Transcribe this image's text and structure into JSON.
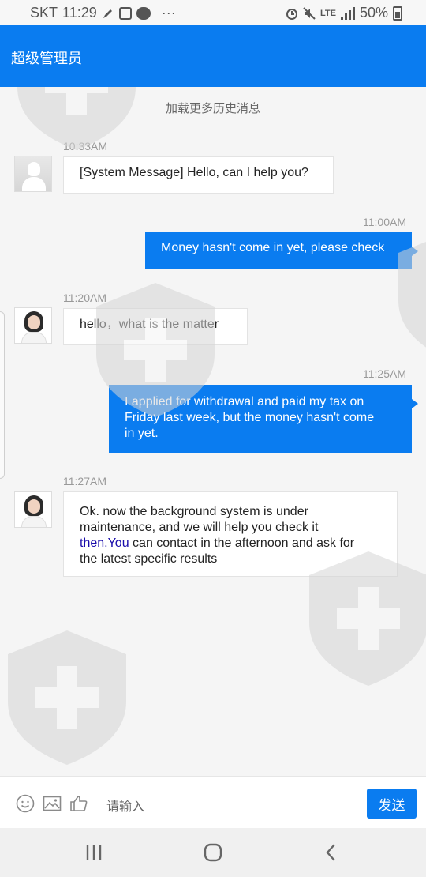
{
  "status_bar": {
    "carrier": "SKT",
    "time": "11:29",
    "network": "LTE",
    "battery": "50%",
    "more": "···"
  },
  "header": {
    "title": "超级管理员"
  },
  "chat": {
    "load_more": "加载更多历史消息",
    "messages": [
      {
        "direction": "in",
        "time": "10:33AM",
        "text": "[System Message] Hello, can I help you?"
      },
      {
        "direction": "out",
        "time": "11:00AM",
        "text": "Money hasn't come in yet, please check"
      },
      {
        "direction": "in",
        "time": "11:20AM",
        "text": "hello，what is the matter"
      },
      {
        "direction": "out",
        "time": "11:25AM",
        "lines": [
          "I applied for withdrawal and paid my tax on",
          "Friday last week, but the money hasn't come",
          "in yet."
        ]
      },
      {
        "direction": "in",
        "time": "11:27AM",
        "lines": [
          "Ok. now the background system is under",
          "maintenance, and we will help you check it"
        ],
        "link": "then.You",
        "after_link": " can contact in the afternoon and ask for",
        "last_line": "the latest specific results"
      }
    ]
  },
  "input_bar": {
    "placeholder": "请输入",
    "send_label": "发送"
  },
  "colors": {
    "accent": "#0a7cf0",
    "background": "#f5f5f5"
  },
  "icons": [
    "smiley-icon",
    "image-icon",
    "thumbs-up-icon",
    "recent-apps-icon",
    "home-icon",
    "back-icon"
  ]
}
